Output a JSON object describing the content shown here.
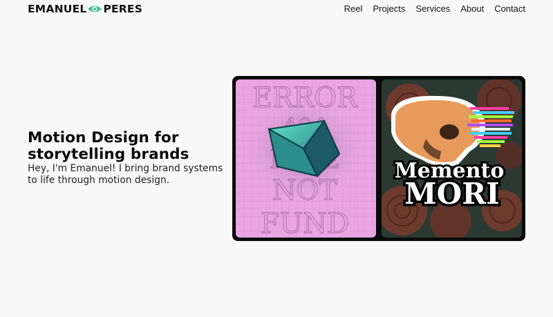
{
  "brand": {
    "first": "EMANUEL",
    "last": "PERES",
    "eye_icon": "eye-icon",
    "accent": "#3fc48f"
  },
  "nav": {
    "items": [
      "Reel",
      "Projects",
      "Services",
      "About",
      "Contact"
    ]
  },
  "hero": {
    "title_line1": "Motion Design for",
    "title_line2": "storytelling brands",
    "subtitle": "Hey, I'm Emanuel! I bring brand systems to life through motion design."
  },
  "artwork": {
    "left": {
      "lines": [
        "ERROR",
        "404",
        "PAGE",
        "NOT",
        "FUND"
      ],
      "background": "#e9a6e3",
      "shape_color": "#3aa597"
    },
    "right": {
      "title_top": "Memento",
      "title_bottom": "MORI",
      "skull_color": "#e89a5a",
      "background": "#2a3a33"
    }
  }
}
